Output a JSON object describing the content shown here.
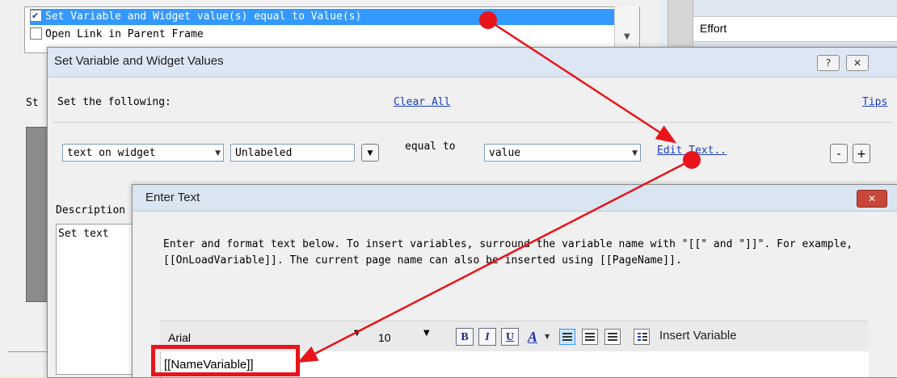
{
  "background": {
    "list_items": [
      {
        "label": "Set Variable and Widget value(s) equal to Value(s)",
        "checked": true,
        "selected": true
      },
      {
        "label": "Open Link in Parent Frame",
        "checked": false,
        "selected": false
      }
    ],
    "left_label": "St",
    "right_field_label": "Effort"
  },
  "dialog_set": {
    "title": "Set Variable and Widget Values",
    "help_glyph": "?",
    "close_glyph": "✕",
    "set_following": "Set the following:",
    "clear_all": "Clear All",
    "tips": "Tips",
    "target_type": "text on widget",
    "widget": "Unlabeled",
    "equal_to": "equal to",
    "value_type": "value",
    "edit_text": "Edit Text..",
    "minus": "-",
    "plus": "+",
    "description_label": "Description",
    "description_text": "Set text"
  },
  "dialog_enter": {
    "title": "Enter Text",
    "close_glyph": "✕",
    "instructions": "Enter and format text below. To insert variables, surround the variable name with \"[[\" and \"]]\". For example, [[OnLoadVariable]]. The current page name can also be inserted using [[PageName]].",
    "font": "Arial",
    "size": "10",
    "bold": "B",
    "italic": "I",
    "underline": "U",
    "color": "A",
    "insert_variable": "Insert Variable",
    "editor_text": "[[NameVariable]]"
  },
  "annotations": {
    "accent_color": "#e8141a"
  }
}
